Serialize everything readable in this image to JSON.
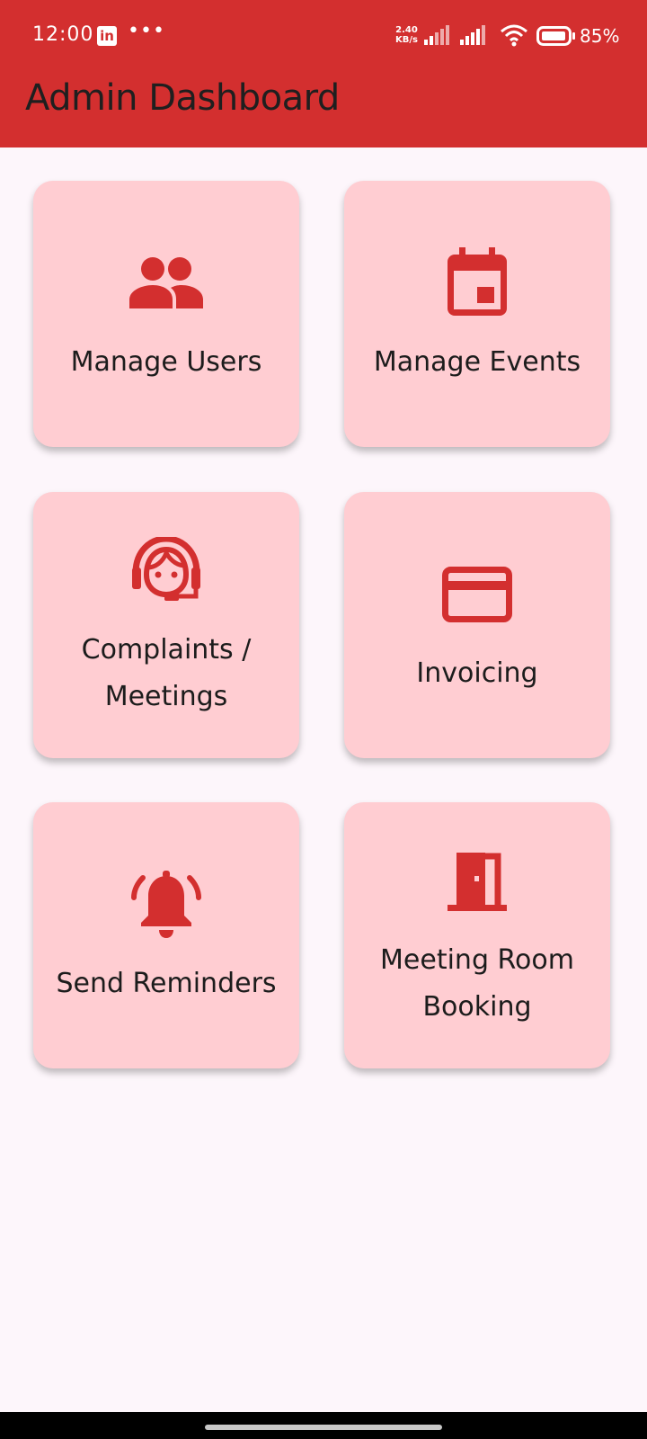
{
  "status_bar": {
    "time": "12:00",
    "notification_app": "in",
    "more_dots": "•••",
    "net_speed_value": "2.40",
    "net_speed_unit": "KB/s",
    "battery_percent": "85%"
  },
  "app_bar": {
    "title": "Admin Dashboard",
    "color": "#d32f2f"
  },
  "cards": [
    {
      "label": "Manage Users",
      "icon": "group-icon"
    },
    {
      "label": "Manage Events",
      "icon": "calendar-icon"
    },
    {
      "label": "Complaints /\nMeetings",
      "icon": "support-agent-icon"
    },
    {
      "label": "Invoicing",
      "icon": "credit-card-icon"
    },
    {
      "label": "Send Reminders",
      "icon": "bell-ringing-icon"
    },
    {
      "label": "Meeting Room\nBooking",
      "icon": "meeting-room-door-icon"
    }
  ],
  "colors": {
    "card_background": "#ffcdd2",
    "icon_color": "#d32f2f",
    "page_background": "#fdf6fb"
  }
}
